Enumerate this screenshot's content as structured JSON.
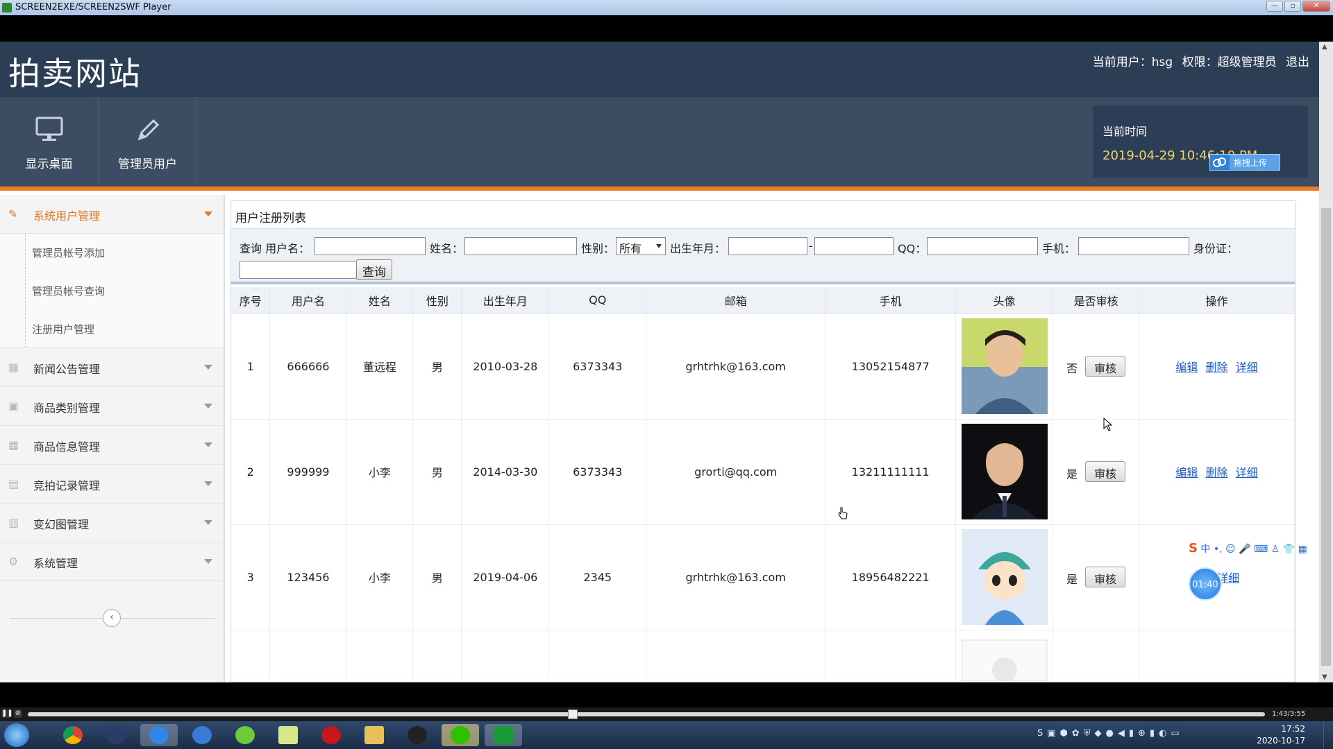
{
  "window": {
    "title": "SCREEN2EXE/SCREEN2SWF Player"
  },
  "site": {
    "title": "拍卖网站",
    "user_label": "当前用户：hsg",
    "role_label": "权限：超级管理员",
    "logout": "退出"
  },
  "nav": {
    "items": [
      {
        "label": "显示桌面",
        "icon": "monitor-icon"
      },
      {
        "label": "管理员用户",
        "icon": "pencil-icon"
      }
    ]
  },
  "time": {
    "label": "当前时间",
    "value": "2019-04-29 10:46:10 PM"
  },
  "upload": {
    "label": "拖拽上传"
  },
  "sidebar": {
    "groups": [
      {
        "label": "系统用户管理",
        "active": true
      },
      {
        "label": "新闻公告管理"
      },
      {
        "label": "商品类别管理"
      },
      {
        "label": "商品信息管理"
      },
      {
        "label": "竞拍记录管理"
      },
      {
        "label": "变幻图管理"
      },
      {
        "label": "系统管理"
      }
    ],
    "subitems": [
      {
        "label": "管理员帐号添加"
      },
      {
        "label": "管理员帐号查询"
      },
      {
        "label": "注册用户管理"
      }
    ]
  },
  "panel": {
    "title": "用户注册列表"
  },
  "search": {
    "username_label": "查询 用户名：",
    "name_label": "姓名：",
    "gender_label": "性别：",
    "gender_selected": "所有",
    "birth_label": "出生年月：",
    "birth_sep": "-",
    "qq_label": "QQ：",
    "phone_label": "手机：",
    "idcard_label": "身份证：",
    "submit_label": "查询"
  },
  "table": {
    "headers": [
      "序号",
      "用户名",
      "姓名",
      "性别",
      "出生年月",
      "QQ",
      "邮箱",
      "手机",
      "头像",
      "是否审核",
      "操作"
    ],
    "rows": [
      {
        "no": "1",
        "username": "666666",
        "name": "董远程",
        "gender": "男",
        "birth": "2010-03-28",
        "qq": "6373343",
        "email": "grhtrhk@163.com",
        "phone": "13052154877",
        "audited": "否",
        "audit_btn": "审核",
        "edit": "编辑",
        "delete": "删除",
        "detail": "详细"
      },
      {
        "no": "2",
        "username": "999999",
        "name": "小李",
        "gender": "男",
        "birth": "2014-03-30",
        "qq": "6373343",
        "email": "grorti@qq.com",
        "phone": "13211111111",
        "audited": "是",
        "audit_btn": "审核",
        "edit": "编辑",
        "delete": "删除",
        "detail": "详细"
      },
      {
        "no": "3",
        "username": "123456",
        "name": "小李",
        "gender": "男",
        "birth": "2019-04-06",
        "qq": "2345",
        "email": "grhtrhk@163.com",
        "phone": "18956482221",
        "audited": "是",
        "audit_btn": "审核",
        "edit": "编",
        "delete": "",
        "detail": "详细"
      }
    ]
  },
  "overlay": {
    "timer": "01:40"
  },
  "player": {
    "time": "1:43/3:55"
  },
  "taskbar": {
    "clock_time": "17:52",
    "clock_date": "2020-10-17"
  },
  "colors": {
    "header": "#2c3e55",
    "nav": "#3b4c63",
    "accent": "#f07a1f",
    "link": "#1a5cc8"
  }
}
